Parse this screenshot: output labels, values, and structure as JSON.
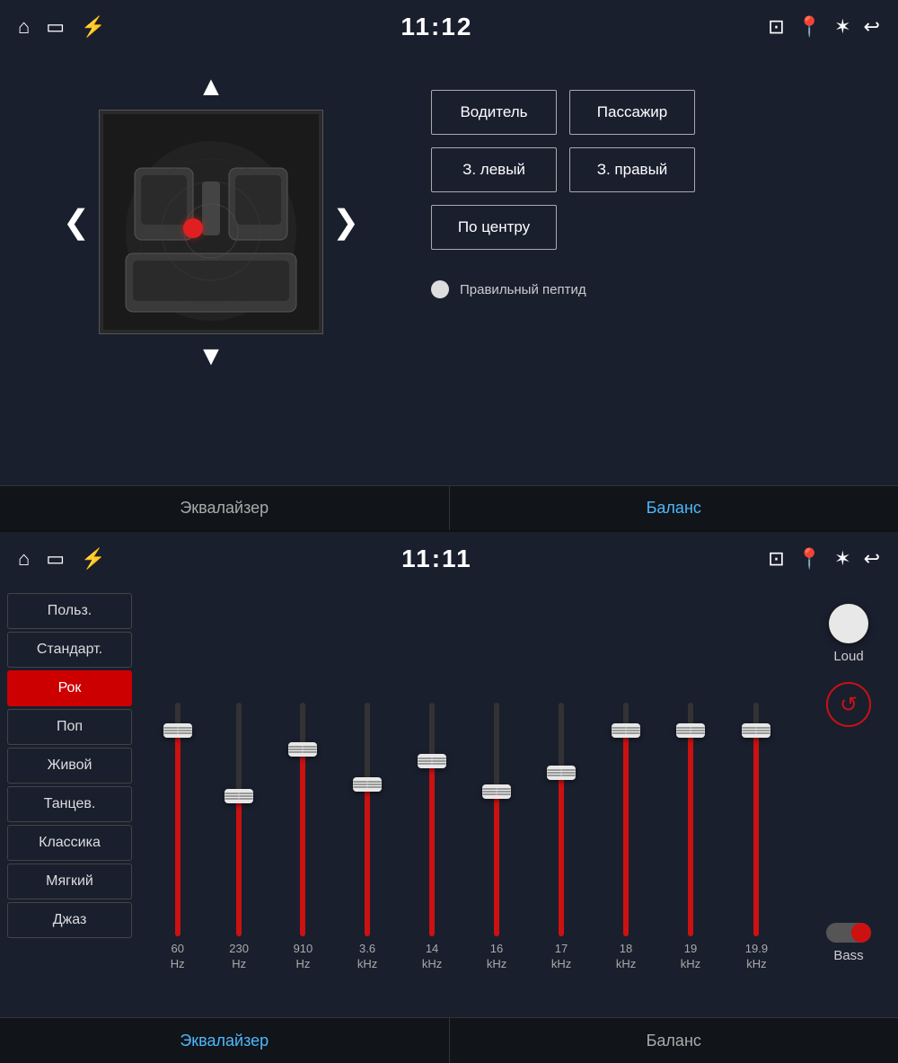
{
  "top": {
    "status_bar": {
      "time": "11:12",
      "icons_left": [
        "home-icon",
        "screen-icon",
        "usb-icon"
      ],
      "icons_right": [
        "cast-icon",
        "location-icon",
        "bluetooth-icon",
        "back-icon"
      ]
    },
    "speaker_buttons": [
      {
        "label": "Водитель",
        "id": "driver"
      },
      {
        "label": "Пассажир",
        "id": "passenger"
      },
      {
        "label": "З. левый",
        "id": "rear-left"
      },
      {
        "label": "З. правый",
        "id": "rear-right"
      },
      {
        "label": "По центру",
        "id": "center"
      }
    ],
    "fade_label": "Правильный пептид",
    "tabs": [
      {
        "label": "Эквалайзер",
        "active": false
      },
      {
        "label": "Баланс",
        "active": true
      }
    ],
    "nav": {
      "up": "▲",
      "down": "▼",
      "left": "‹",
      "right": "›"
    }
  },
  "bottom": {
    "status_bar": {
      "time": "11:11",
      "icons_left": [
        "home-icon",
        "screen-icon",
        "usb-icon"
      ],
      "icons_right": [
        "cast-icon",
        "location-icon",
        "bluetooth-icon",
        "back-icon"
      ]
    },
    "presets": [
      {
        "label": "Польз.",
        "active": false
      },
      {
        "label": "Стандарт.",
        "active": false
      },
      {
        "label": "Рок",
        "active": true
      },
      {
        "label": "Поп",
        "active": false
      },
      {
        "label": "Живой",
        "active": false
      },
      {
        "label": "Танцев.",
        "active": false
      },
      {
        "label": "Классика",
        "active": false
      },
      {
        "label": "Мягкий",
        "active": false
      },
      {
        "label": "Джаз",
        "active": false
      }
    ],
    "eq_bands": [
      {
        "freq": "60",
        "unit": "Hz",
        "fill_pct": 88,
        "handle_pct": 88
      },
      {
        "freq": "230",
        "unit": "Hz",
        "fill_pct": 60,
        "handle_pct": 60
      },
      {
        "freq": "910",
        "unit": "Hz",
        "fill_pct": 80,
        "handle_pct": 80
      },
      {
        "freq": "3.6",
        "unit": "kHz",
        "fill_pct": 65,
        "handle_pct": 65
      },
      {
        "freq": "14",
        "unit": "kHz",
        "fill_pct": 75,
        "handle_pct": 75
      },
      {
        "freq": "16",
        "unit": "kHz",
        "fill_pct": 62,
        "handle_pct": 62
      },
      {
        "freq": "17",
        "unit": "kHz",
        "fill_pct": 70,
        "handle_pct": 70
      },
      {
        "freq": "18",
        "unit": "kHz",
        "fill_pct": 88,
        "handle_pct": 88
      },
      {
        "freq": "19",
        "unit": "kHz",
        "fill_pct": 88,
        "handle_pct": 88
      },
      {
        "freq": "19.9",
        "unit": "kHz",
        "fill_pct": 88,
        "handle_pct": 88
      }
    ],
    "controls": {
      "loud_label": "Loud",
      "reset_icon": "↺",
      "bass_label": "Bass"
    },
    "tabs": [
      {
        "label": "Эквалайзер",
        "active": true
      },
      {
        "label": "Баланс",
        "active": false
      }
    ]
  }
}
